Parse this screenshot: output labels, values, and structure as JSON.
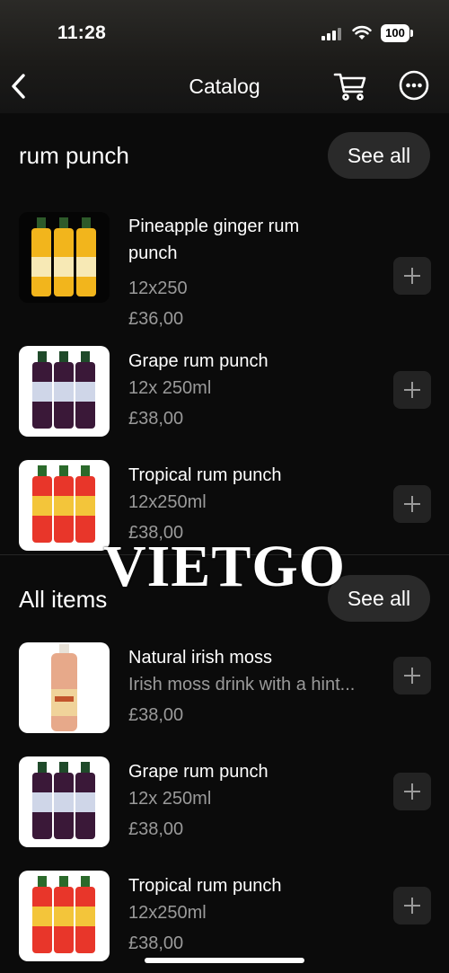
{
  "status": {
    "time": "11:28",
    "battery": "100"
  },
  "nav": {
    "title": "Catalog",
    "icons": {
      "back": "chevron-left-icon",
      "cart": "cart-icon",
      "more": "more-icon"
    }
  },
  "sections": [
    {
      "title": "rum punch",
      "see_all": "See all",
      "items": [
        {
          "name": "Pineapple ginger rum punch",
          "desc": "12x250",
          "price": "£36,00",
          "image": "yellow-bottles"
        },
        {
          "name": "Grape rum punch",
          "desc": "12x 250ml",
          "price": "£38,00",
          "image": "dark-bottles"
        },
        {
          "name": "Tropical rum punch",
          "desc": "12x250ml",
          "price": "£38,00",
          "image": "red-bottles"
        }
      ]
    },
    {
      "title": "All items",
      "see_all": "See all",
      "items": [
        {
          "name": "Natural irish moss",
          "desc": "Irish moss drink with a hint...",
          "price": "£38,00",
          "image": "single-bottle"
        },
        {
          "name": "Grape rum punch",
          "desc": "12x 250ml",
          "price": "£38,00",
          "image": "dark-bottles"
        },
        {
          "name": "Tropical rum punch",
          "desc": "12x250ml",
          "price": "£38,00",
          "image": "red-bottles"
        }
      ]
    }
  ],
  "watermark": "VIETGO",
  "colors": {
    "background": "#0b0b0b",
    "secondary_text": "#9a9a9a",
    "button_bg": "#2a2a2a"
  }
}
